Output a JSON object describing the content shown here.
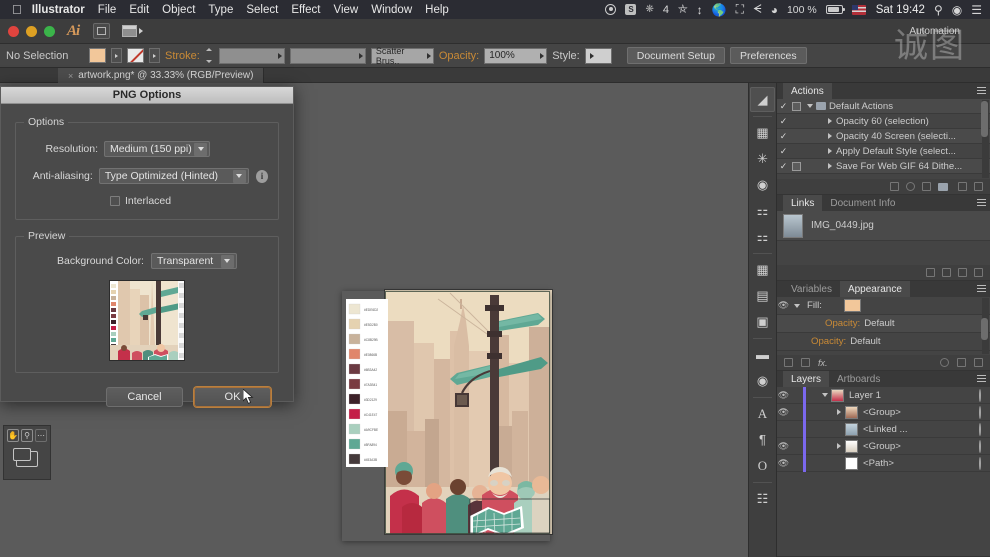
{
  "menubar": {
    "apple_icon": "apple-icon",
    "items": [
      {
        "label": "Illustrator",
        "bold": true
      },
      {
        "label": "File",
        "bold": false
      },
      {
        "label": "Edit",
        "bold": false
      },
      {
        "label": "Object",
        "bold": false
      },
      {
        "label": "Type",
        "bold": false
      },
      {
        "label": "Select",
        "bold": false
      },
      {
        "label": "Effect",
        "bold": false
      },
      {
        "label": "View",
        "bold": false
      },
      {
        "label": "Window",
        "bold": false
      },
      {
        "label": "Help",
        "bold": false
      }
    ],
    "status": {
      "record_icon": "record-icon",
      "skype_icon": "skype-icon",
      "dropbox_count": "4",
      "shield_icon": "shield-icon",
      "sync_icon": "sync-icon",
      "globe_icon": "globe-icon",
      "airplay_icon": "airplay-icon",
      "bluetooth_icon": "bluetooth-icon",
      "wifi_icon": "wifi-icon",
      "battery_percent": "100 %",
      "battery_icon": "battery-charging-icon",
      "flag_icon": "us-flag-icon",
      "clock": "Sat 19:42",
      "search_icon": "spotlight-search-icon",
      "siri_icon": "siri-icon",
      "notification_icon": "notification-center-icon"
    }
  },
  "appbar": {
    "app_logo": "Ai",
    "bridge_button": "bridge-icon",
    "arrange_label": "arrange-documents-icon"
  },
  "controlbar": {
    "selection_status": "No Selection",
    "fill_swatch_color": "#f2c79a",
    "stroke_label": "Stroke:",
    "stroke_weight": "",
    "stroke_profile": "",
    "brush_definition": "Scatter Brus..",
    "opacity_label": "Opacity:",
    "opacity_value": "100%",
    "style_label": "Style:",
    "document_setup_button": "Document Setup",
    "preferences_button": "Preferences"
  },
  "tabbar": {
    "document_tab": "artwork.png* @ 33.33% (RGB/Preview)",
    "close_glyph": "×"
  },
  "dialog": {
    "title": "PNG Options",
    "options_group": "Options",
    "resolution_label": "Resolution:",
    "resolution_value": "Medium (150 ppi)",
    "antialiasing_label": "Anti-aliasing:",
    "antialiasing_value": "Type Optimized (Hinted)",
    "info_icon": "info-icon",
    "interlaced_label": "Interlaced",
    "interlaced_checked": false,
    "preview_group": "Preview",
    "background_color_label": "Background Color:",
    "background_color_value": "Transparent",
    "cancel_button": "Cancel",
    "ok_button": "OK",
    "focus_ring_color": "#b9803f"
  },
  "rail": {
    "items": [
      {
        "name": "gradient-tool-icon",
        "glyph": "◤"
      },
      {
        "name": "swatches-panel-icon",
        "glyph": "▦"
      },
      {
        "name": "brushes-panel-icon",
        "glyph": "✑"
      },
      {
        "name": "color-panel-icon",
        "glyph": "◕"
      },
      {
        "name": "symbols-panel-icon",
        "glyph": "❏"
      },
      {
        "name": "graphic-styles-panel-icon",
        "glyph": "❐"
      },
      {
        "name": "transform-panel-icon",
        "glyph": "⬚"
      },
      {
        "name": "align-panel-icon",
        "glyph": "▤"
      },
      {
        "name": "pathfinder-panel-icon",
        "glyph": "◳"
      },
      {
        "name": "transparency-panel-icon",
        "glyph": "▭"
      },
      {
        "name": "stroke-panel-icon",
        "glyph": "◎"
      },
      {
        "name": "character-panel-icon",
        "glyph": "A"
      },
      {
        "name": "paragraph-panel-icon",
        "glyph": "¶"
      },
      {
        "name": "opentype-panel-icon",
        "glyph": "O"
      },
      {
        "name": "links-panel-icon",
        "glyph": "⛓"
      }
    ]
  },
  "panels": {
    "automation_tab": "Automation",
    "actions": {
      "tab": "Actions",
      "rows": [
        {
          "check": "✓",
          "box": true,
          "disclosure": "down",
          "folder": true,
          "label": "Default Actions",
          "indent": 0
        },
        {
          "check": "✓",
          "box": false,
          "disclosure": "right",
          "folder": false,
          "label": "Opacity 60 (selection)",
          "indent": 1
        },
        {
          "check": "✓",
          "box": false,
          "disclosure": "right",
          "folder": false,
          "label": "Opacity 40 Screen (selecti...",
          "indent": 1
        },
        {
          "check": "✓",
          "box": false,
          "disclosure": "right",
          "folder": false,
          "label": "Apply Default Style (select...",
          "indent": 1
        },
        {
          "check": "✓",
          "box": true,
          "disclosure": "right",
          "folder": false,
          "label": "Save For Web GIF 64 Dithe...",
          "indent": 1
        }
      ],
      "footer_icons": [
        "stop-icon",
        "record-icon",
        "play-icon",
        "new-set-icon",
        "new-action-icon",
        "delete-icon"
      ]
    },
    "links": {
      "tabs": [
        "Links",
        "Document Info"
      ],
      "active_tab": "Links",
      "items": [
        {
          "name": "IMG_0449.jpg",
          "thumb": "image-thumbnail"
        }
      ],
      "footer_icons": [
        "relink-icon",
        "goto-link-icon",
        "update-link-icon",
        "edit-original-icon"
      ]
    },
    "appearance": {
      "tabs": [
        "Variables",
        "Appearance"
      ],
      "active_tab": "Appearance",
      "rows": [
        {
          "eye": true,
          "disclosure": true,
          "label": "Fill:",
          "swatch": "#f2c79a",
          "highlight": false,
          "sub": false
        },
        {
          "eye": false,
          "disclosure": false,
          "label_amber": "Opacity:",
          "label": "Default",
          "highlight": true,
          "sub": true
        },
        {
          "eye": false,
          "disclosure": false,
          "label_amber": "Opacity:",
          "label": "Default",
          "highlight": false,
          "sub": false
        }
      ],
      "footer_icons": [
        "add-new-fill-icon",
        "add-new-stroke-icon",
        "add-new-effect-icon",
        "clear-appearance-icon",
        "duplicate-item-icon",
        "delete-item-icon"
      ]
    },
    "layers": {
      "tabs": [
        "Layers",
        "Artboards"
      ],
      "active_tab": "Layers",
      "rows": [
        {
          "eye": true,
          "disclosure": "down",
          "label": "Layer 1",
          "indent": 0,
          "target": true,
          "color": "#7b68ee"
        },
        {
          "eye": true,
          "disclosure": "right",
          "label": "<Group>",
          "indent": 1,
          "target": true,
          "color": "#7b68ee"
        },
        {
          "eye": false,
          "disclosure": "",
          "label": "<Linked ...",
          "indent": 2,
          "target": true,
          "color": "#7b68ee"
        },
        {
          "eye": true,
          "disclosure": "right",
          "label": "<Group>",
          "indent": 1,
          "target": true,
          "color": "#7b68ee"
        },
        {
          "eye": true,
          "disclosure": "",
          "label": "<Path>",
          "indent": 1,
          "target": true,
          "color": "#7b68ee"
        }
      ]
    }
  },
  "artwork": {
    "swatch_labels": [
      "#EDE6D2",
      "#E5D2B0",
      "#C8B29B",
      "#E0866B",
      "#6B3A42",
      "#7A3B41",
      "#3D2129",
      "#C41E47",
      "#A9CFBE",
      "#5FA894",
      "#453A3B"
    ],
    "swatch_colors": [
      "#ede6d2",
      "#e5d2b0",
      "#c8b29b",
      "#e0866b",
      "#6b3a42",
      "#7a3b41",
      "#3d2129",
      "#c41e47",
      "#a9cfbe",
      "#5fa894",
      "#453a3b"
    ],
    "description": "city-street-illustration"
  },
  "minipanel": {
    "hand_tool": "hand-tool-icon",
    "zoom_tool": "zoom-tool-icon",
    "screen_mode": "screen-mode-icon"
  }
}
